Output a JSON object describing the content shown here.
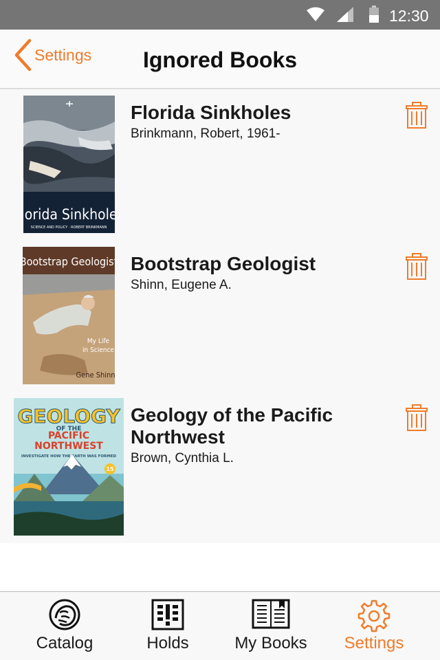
{
  "status_bar": {
    "time": "12:30"
  },
  "nav": {
    "back_label": "Settings",
    "title": "Ignored Books"
  },
  "books": [
    {
      "title": "Florida Sinkholes",
      "author": "Brinkmann, Robert, 1961-",
      "cover_title": "Florida Sinkholes",
      "cover_subtitle": "SCIENCE AND POLICY · ROBERT BRINKMANN"
    },
    {
      "title": "Bootstrap Geologist",
      "author": "Shinn, Eugene A.",
      "cover_title": "Bootstrap Geologist",
      "cover_subtitle_1": "My Life",
      "cover_subtitle_2": "in Science",
      "cover_author": "Gene Shinn"
    },
    {
      "title": "Geology of the Pacific Northwest",
      "author": "Brown, Cynthia L.",
      "cover_title_1": "GEOLOGY",
      "cover_title_2": "OF THE",
      "cover_title_3": "PACIFIC",
      "cover_title_4": "NORTHWEST",
      "cover_tagline": "INVESTIGATE HOW THE EARTH WAS FORMED",
      "cover_badge": "15"
    }
  ],
  "tabs": [
    {
      "label": "Catalog",
      "icon": "lion-logo-icon",
      "active": false
    },
    {
      "label": "Holds",
      "icon": "holds-icon",
      "active": false
    },
    {
      "label": "My Books",
      "icon": "book-icon",
      "active": false
    },
    {
      "label": "Settings",
      "icon": "gear-icon",
      "active": true
    }
  ],
  "colors": {
    "accent": "#f07b2a",
    "status_bar": "#757575",
    "list_bg": "#f8f8f8"
  }
}
